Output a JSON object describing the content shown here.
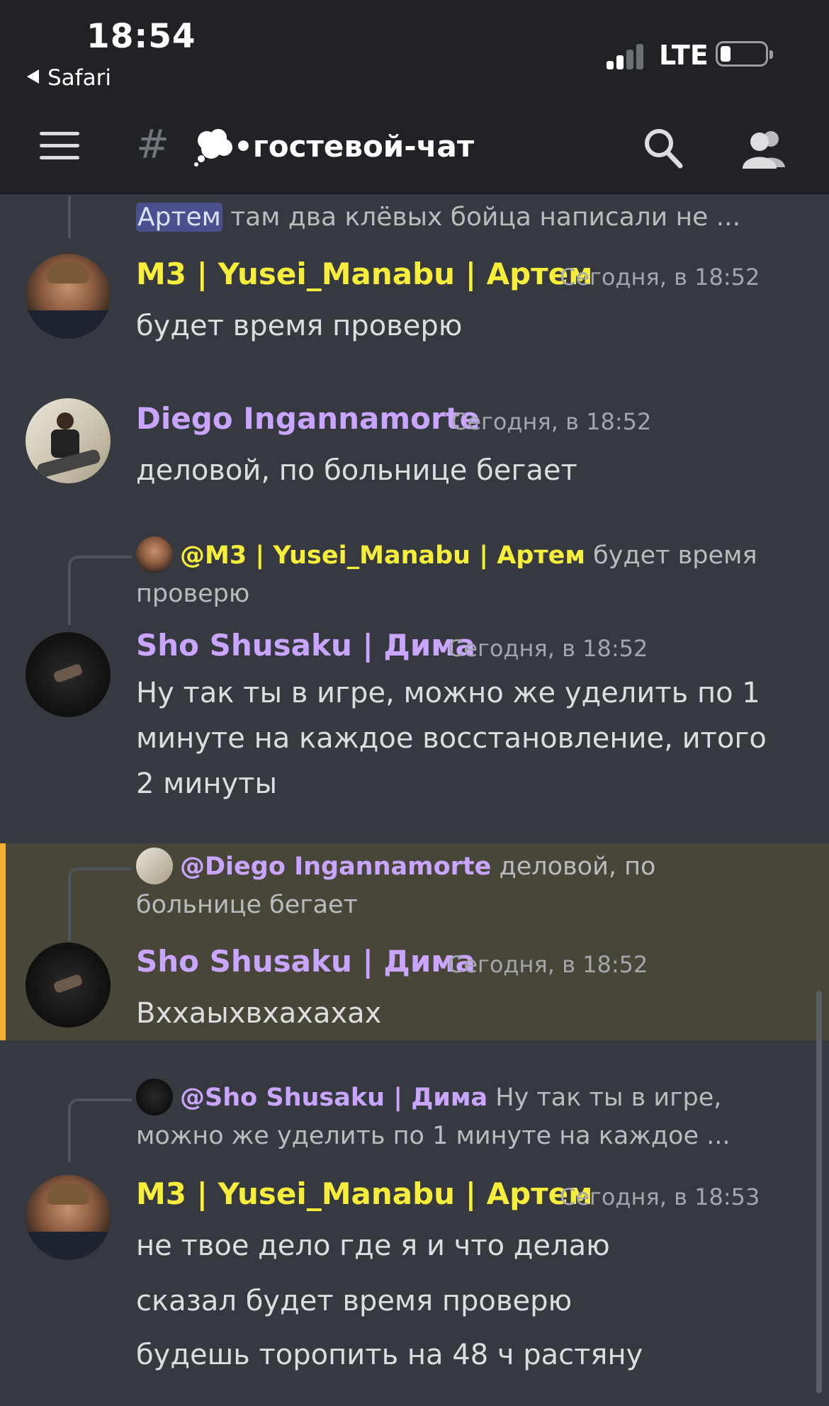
{
  "status": {
    "time": "18:54",
    "back_label": "Safari",
    "network": "LTE"
  },
  "header": {
    "channel_name": "•гостевой-чат",
    "channel_icon": "thought-cloud-icon"
  },
  "top_reply": {
    "mention": "Артем",
    "text": " там два клёвых бойца написали не ..."
  },
  "messages": [
    {
      "author": "M3 | Yusei_Manabu | Артем",
      "timestamp": "Сегодня, в 18:52",
      "color": "#f7ed3b",
      "lines": [
        "будет время проверю"
      ]
    },
    {
      "author": "Diego Ingannamorte",
      "timestamp": "Сегодня, в 18:52",
      "color": "#c9a5ff",
      "lines": [
        "деловой, по больнице бегает"
      ]
    },
    {
      "reply_to": {
        "name": "@M3 | Yusei_Manabu | Артем",
        "text": "будет время проверю"
      },
      "author": "Sho Shusaku | Дима",
      "timestamp": "Сегодня, в 18:52",
      "color": "#c9a5ff",
      "lines": [
        "Ну так ты в игре, можно же уделить по 1 минуте на каждое восстановление, итого 2 минуты"
      ]
    },
    {
      "reply_to": {
        "name": "@Diego Ingannamorte",
        "text": "деловой, по больнице бегает"
      },
      "author": "Sho Shusaku | Дима",
      "timestamp": "Сегодня, в 18:52",
      "color": "#c9a5ff",
      "highlighted": true,
      "lines": [
        "Вххаыхвхахахах"
      ]
    },
    {
      "reply_to": {
        "name": "@Sho Shusaku | Дима",
        "text": "Ну так ты в игре, можно же уделить по 1 минуте на каждое ..."
      },
      "author": "M3 | Yusei_Manabu | Артем",
      "timestamp": "Сегодня, в 18:53",
      "color": "#f7ed3b",
      "lines": [
        "не твое дело где я и что делаю",
        "сказал будет время проверю",
        "будешь торопить на 48 ч растяну"
      ]
    }
  ]
}
